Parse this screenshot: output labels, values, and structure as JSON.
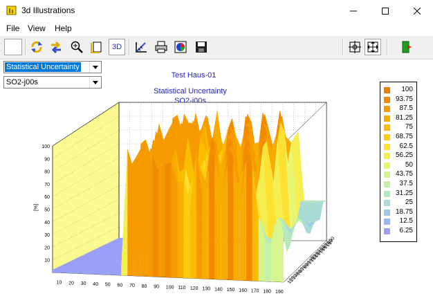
{
  "window": {
    "title": "3d Illustrations"
  },
  "menu": {
    "file": "File",
    "view": "View",
    "help": "Help"
  },
  "toolbar": {
    "btn_3d": "3D"
  },
  "controls": {
    "measure_select": "Statistical Uncertainty",
    "series_select": "SO2-j00s"
  },
  "chart_data": {
    "type": "3d-surface",
    "title": "Test Haus-01",
    "subtitle_1": "Statistical Uncertainty",
    "subtitle_2": "SO2-j00s",
    "zlabel": "[%]",
    "zticks": [
      "100",
      "90",
      "80",
      "70",
      "60",
      "50",
      "40",
      "30",
      "20",
      "10"
    ],
    "xticks": [
      "10",
      "20",
      "30",
      "40",
      "50",
      "60",
      "70",
      "80",
      "90",
      "100",
      "110",
      "120",
      "130",
      "140",
      "150",
      "160",
      "170",
      "180",
      "190"
    ],
    "yticks": [
      "10",
      "20",
      "30",
      "40",
      "50",
      "60",
      "70",
      "80",
      "90",
      "100",
      "110",
      "120",
      "130",
      "140",
      "150",
      "160",
      "170",
      "180",
      "190"
    ],
    "legend": [
      {
        "label": "100",
        "color": "#f07a00"
      },
      {
        "label": "93.75",
        "color": "#f28a00"
      },
      {
        "label": "87.5",
        "color": "#f59a00"
      },
      {
        "label": "81.25",
        "color": "#f8ab00"
      },
      {
        "label": "75",
        "color": "#fbbd00"
      },
      {
        "label": "68.75",
        "color": "#fdcd10"
      },
      {
        "label": "62.5",
        "color": "#fde030"
      },
      {
        "label": "56.25",
        "color": "#f4ee50"
      },
      {
        "label": "50",
        "color": "#e8f570"
      },
      {
        "label": "43.75",
        "color": "#d6f590"
      },
      {
        "label": "37.5",
        "color": "#c4f0a8"
      },
      {
        "label": "31.25",
        "color": "#b4e8c0"
      },
      {
        "label": "25",
        "color": "#a8dcd4"
      },
      {
        "label": "18.75",
        "color": "#a0c8e8"
      },
      {
        "label": "12.5",
        "color": "#9ab4f4"
      },
      {
        "label": "6.25",
        "color": "#9aa0f8"
      }
    ]
  }
}
